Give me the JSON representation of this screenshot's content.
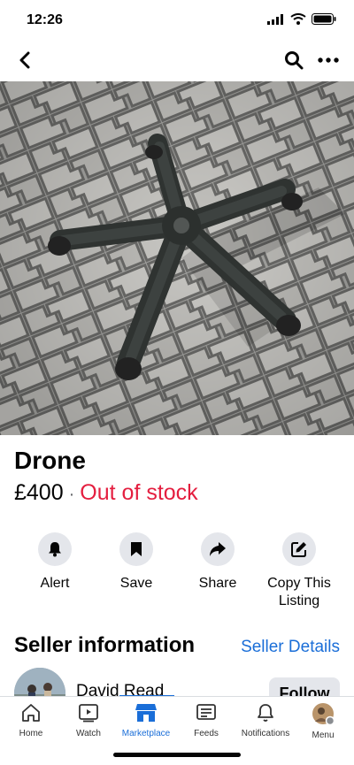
{
  "status_bar": {
    "time": "12:26"
  },
  "listing": {
    "title": "Drone",
    "price": "£400",
    "separator": "·",
    "availability": "Out of stock"
  },
  "actions": [
    {
      "label": "Alert",
      "icon": "bell-icon"
    },
    {
      "label": "Save",
      "icon": "bookmark-icon"
    },
    {
      "label": "Share",
      "icon": "share-arrow-icon"
    },
    {
      "label": "Copy This Listing",
      "icon": "edit-square-icon"
    }
  ],
  "seller": {
    "heading": "Seller information",
    "details_link": "Seller Details",
    "name": "David Read",
    "follow_label": "Follow"
  },
  "tabs": [
    {
      "label": "Home",
      "icon": "home-icon"
    },
    {
      "label": "Watch",
      "icon": "video-icon"
    },
    {
      "label": "Marketplace",
      "icon": "shop-icon",
      "active": true
    },
    {
      "label": "Feeds",
      "icon": "feeds-icon"
    },
    {
      "label": "Notifications",
      "icon": "bell-icon"
    },
    {
      "label": "Menu",
      "icon": "avatar-icon"
    }
  ],
  "colors": {
    "accent": "#1a6ed8",
    "out_of_stock": "#e41e3f",
    "button_bg": "#e4e6eb"
  }
}
